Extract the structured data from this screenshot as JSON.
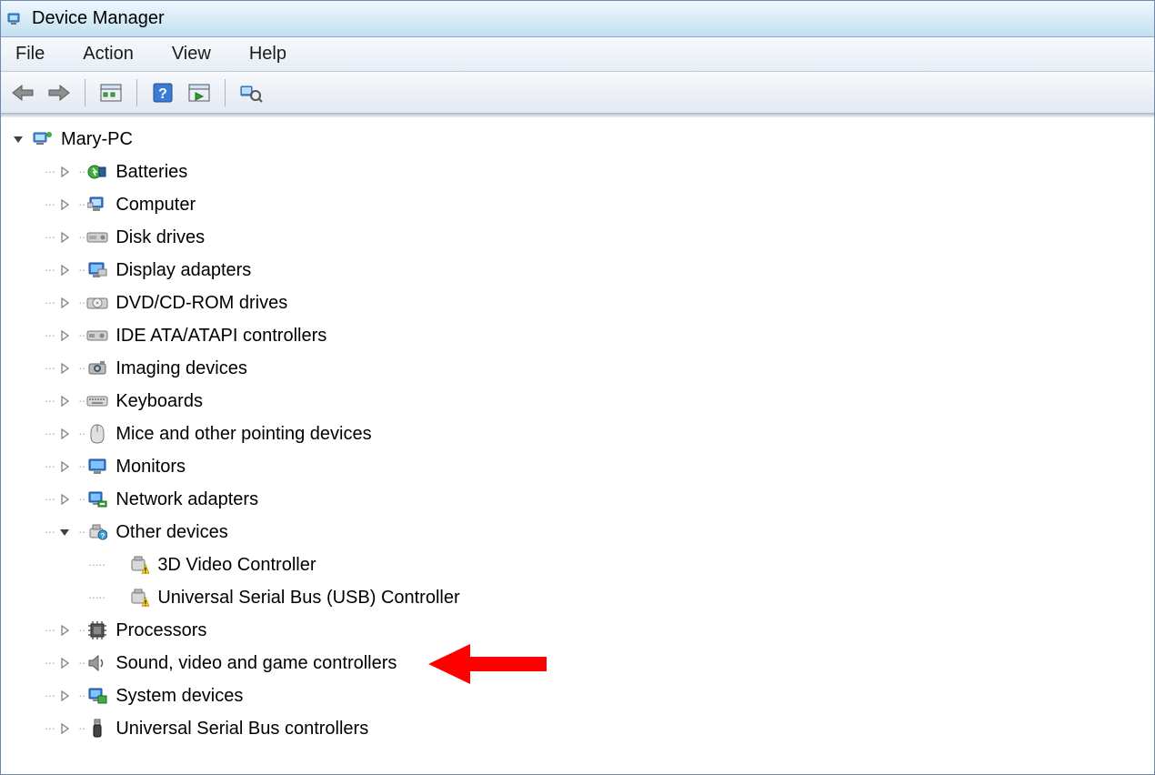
{
  "window": {
    "title": "Device Manager"
  },
  "menu": {
    "items": [
      {
        "label": "File"
      },
      {
        "label": "Action"
      },
      {
        "label": "View"
      },
      {
        "label": "Help"
      }
    ]
  },
  "toolbar": {
    "buttons": [
      {
        "name": "nav-back-button",
        "icon": "arrow-left-icon"
      },
      {
        "name": "nav-forward-button",
        "icon": "arrow-right-icon"
      },
      {
        "sep": true
      },
      {
        "name": "show-hide-console-button",
        "icon": "console-tree-icon"
      },
      {
        "sep": true
      },
      {
        "name": "help-button",
        "icon": "help-icon"
      },
      {
        "name": "action-pane-button",
        "icon": "action-pane-icon"
      },
      {
        "sep": true
      },
      {
        "name": "scan-hardware-button",
        "icon": "scan-hardware-icon"
      }
    ]
  },
  "tree": {
    "root": {
      "label": "Mary-PC",
      "expanded": true,
      "icon": "computer-icon"
    },
    "items": [
      {
        "label": "Batteries",
        "icon": "battery-icon",
        "expanded": false
      },
      {
        "label": "Computer",
        "icon": "computer-node-icon",
        "expanded": false
      },
      {
        "label": "Disk drives",
        "icon": "disk-drive-icon",
        "expanded": false
      },
      {
        "label": "Display adapters",
        "icon": "display-adapter-icon",
        "expanded": false
      },
      {
        "label": "DVD/CD-ROM drives",
        "icon": "dvd-drive-icon",
        "expanded": false
      },
      {
        "label": "IDE ATA/ATAPI controllers",
        "icon": "ide-controller-icon",
        "expanded": false
      },
      {
        "label": "Imaging devices",
        "icon": "imaging-device-icon",
        "expanded": false
      },
      {
        "label": "Keyboards",
        "icon": "keyboard-icon",
        "expanded": false
      },
      {
        "label": "Mice and other pointing devices",
        "icon": "mouse-icon",
        "expanded": false
      },
      {
        "label": "Monitors",
        "icon": "monitor-icon",
        "expanded": false
      },
      {
        "label": "Network adapters",
        "icon": "network-adapter-icon",
        "expanded": false
      },
      {
        "label": "Other devices",
        "icon": "other-devices-icon",
        "expanded": true,
        "children": [
          {
            "label": "3D Video Controller",
            "icon": "warning-device-icon"
          },
          {
            "label": "Universal Serial Bus (USB) Controller",
            "icon": "warning-device-icon"
          }
        ]
      },
      {
        "label": "Processors",
        "icon": "processor-icon",
        "expanded": false
      },
      {
        "label": "Sound, video and game controllers",
        "icon": "sound-icon",
        "expanded": false
      },
      {
        "label": "System devices",
        "icon": "system-device-icon",
        "expanded": false
      },
      {
        "label": "Universal Serial Bus controllers",
        "icon": "usb-controller-icon",
        "expanded": false
      }
    ]
  }
}
